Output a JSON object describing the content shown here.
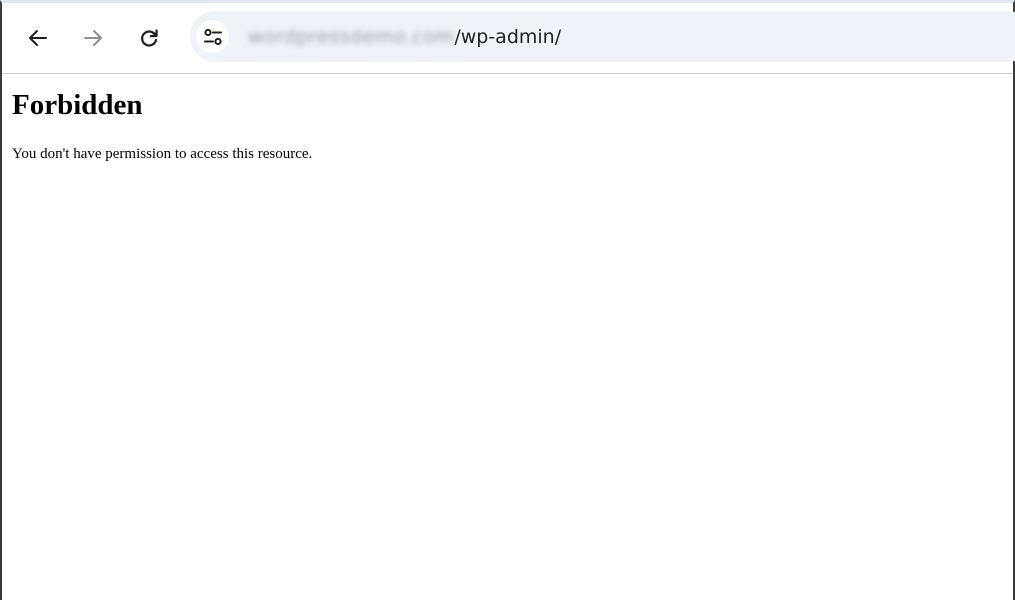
{
  "browser": {
    "url_domain": "wordpressdemo.com",
    "url_path": "/wp-admin/",
    "icons": {
      "back": "arrow-left-icon",
      "forward": "arrow-right-icon",
      "reload": "reload-icon",
      "site_info": "tune-icon"
    }
  },
  "page": {
    "heading": "Forbidden",
    "message": "You don't have permission to access this resource."
  },
  "colors": {
    "omnibox_bg": "#eef2f9",
    "forward_disabled": "#9aa0a6",
    "icon": "#1f1f1f"
  }
}
